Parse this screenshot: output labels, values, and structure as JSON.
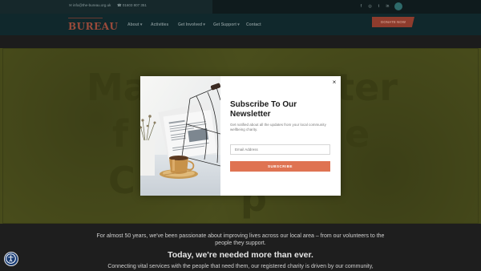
{
  "topbar": {
    "email": "✉ info@the-bureau.org.uk",
    "phone": "☎ 01603 807 351",
    "social": [
      "f",
      "◎",
      "t",
      "in"
    ]
  },
  "header": {
    "logo": "BUREAU",
    "nav": [
      {
        "label": "About ▾"
      },
      {
        "label": "Activities"
      },
      {
        "label": "Get Involved ▾"
      },
      {
        "label": "Get Support ▾"
      },
      {
        "label": "Contact"
      }
    ],
    "donate_label": "DONATE NOW"
  },
  "hero": {
    "word1": "Ma",
    "word2": "ter",
    "word3": "f",
    "word4": "e",
    "word5": "C",
    "word6": "p"
  },
  "content": {
    "intro": "For almost 50 years, we've been passionate about improving lives across our local area – from our volunteers to the people they support.",
    "heading": "Today, we're needed more than ever.",
    "intro2": "Connecting vital services with the people that need them, our registered charity is driven by our community,"
  },
  "modal": {
    "title": "Subscribe To Our Newsletter",
    "description": "Get notified about all the updates from your local community wellbeing charity.",
    "email_placeholder": "Email Address",
    "email_value": "",
    "button_label": "SUBSCRIBE",
    "close_label": "×"
  },
  "colors": {
    "accent": "#df7352",
    "nav_bg": "#10282c",
    "hero_bg": "#4a4e1c",
    "accessibility_bg": "#173a72"
  },
  "icons": {
    "close": "close-icon",
    "accessibility": "accessibility-icon",
    "email": "envelope-icon",
    "phone": "phone-icon"
  }
}
